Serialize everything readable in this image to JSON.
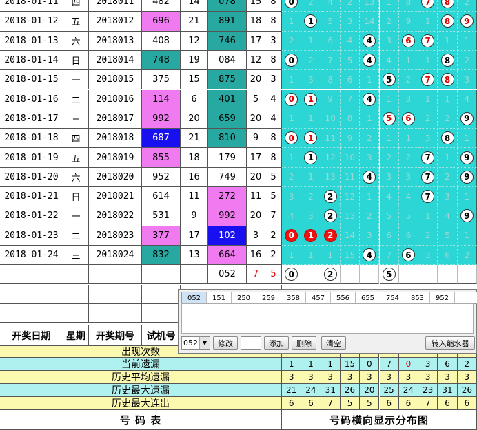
{
  "rows": [
    {
      "date": "2018-01-11",
      "weekday": "四",
      "issue": "2018011",
      "trial": "482",
      "trial_style": "",
      "trial_sum": "14",
      "draw": "078",
      "draw_style": "teal",
      "sum": "15",
      "span": "8",
      "dist": [
        {
          "t": "b",
          "v": "0"
        },
        {
          "t": "n",
          "v": "2"
        },
        {
          "t": "n",
          "v": "4"
        },
        {
          "t": "n",
          "v": "2"
        },
        {
          "t": "n",
          "v": "13"
        },
        {
          "t": "n",
          "v": "1"
        },
        {
          "t": "n",
          "v": "8"
        },
        {
          "t": "r",
          "v": "7"
        },
        {
          "t": "r",
          "v": "8"
        },
        {
          "t": "n",
          "v": "2"
        }
      ]
    },
    {
      "date": "2018-01-12",
      "weekday": "五",
      "issue": "2018012",
      "trial": "696",
      "trial_style": "pink",
      "trial_sum": "21",
      "draw": "891",
      "draw_style": "teal",
      "sum": "18",
      "span": "8",
      "dist": [
        {
          "t": "n",
          "v": "1"
        },
        {
          "t": "b",
          "v": "1"
        },
        {
          "t": "n",
          "v": "5"
        },
        {
          "t": "n",
          "v": "3"
        },
        {
          "t": "n",
          "v": "14"
        },
        {
          "t": "n",
          "v": "2"
        },
        {
          "t": "n",
          "v": "9"
        },
        {
          "t": "n",
          "v": "1"
        },
        {
          "t": "r",
          "v": "8"
        },
        {
          "t": "r",
          "v": "9"
        }
      ]
    },
    {
      "date": "2018-01-13",
      "weekday": "六",
      "issue": "2018013",
      "trial": "408",
      "trial_style": "",
      "trial_sum": "12",
      "draw": "746",
      "draw_style": "teal",
      "sum": "17",
      "span": "3",
      "dist": [
        {
          "t": "n",
          "v": "2"
        },
        {
          "t": "n",
          "v": "1"
        },
        {
          "t": "n",
          "v": "6"
        },
        {
          "t": "n",
          "v": "4"
        },
        {
          "t": "b",
          "v": "4"
        },
        {
          "t": "n",
          "v": "3"
        },
        {
          "t": "r",
          "v": "6"
        },
        {
          "t": "r",
          "v": "7"
        },
        {
          "t": "n",
          "v": "1"
        },
        {
          "t": "n",
          "v": "1"
        }
      ]
    },
    {
      "date": "2018-01-14",
      "weekday": "日",
      "issue": "2018014",
      "trial": "748",
      "trial_style": "teal",
      "trial_sum": "19",
      "draw": "084",
      "draw_style": "",
      "sum": "12",
      "span": "8",
      "dist": [
        {
          "t": "b",
          "v": "0"
        },
        {
          "t": "n",
          "v": "2"
        },
        {
          "t": "n",
          "v": "7"
        },
        {
          "t": "n",
          "v": "5"
        },
        {
          "t": "b",
          "v": "4"
        },
        {
          "t": "n",
          "v": "4"
        },
        {
          "t": "n",
          "v": "1"
        },
        {
          "t": "n",
          "v": "1"
        },
        {
          "t": "b",
          "v": "8"
        },
        {
          "t": "n",
          "v": "2"
        }
      ]
    },
    {
      "date": "2018-01-15",
      "weekday": "一",
      "issue": "2018015",
      "trial": "375",
      "trial_style": "",
      "trial_sum": "15",
      "draw": "875",
      "draw_style": "teal",
      "sum": "20",
      "span": "3",
      "dist": [
        {
          "t": "n",
          "v": "1"
        },
        {
          "t": "n",
          "v": "3"
        },
        {
          "t": "n",
          "v": "8"
        },
        {
          "t": "n",
          "v": "6"
        },
        {
          "t": "n",
          "v": "1"
        },
        {
          "t": "b",
          "v": "5"
        },
        {
          "t": "n",
          "v": "2"
        },
        {
          "t": "r",
          "v": "7"
        },
        {
          "t": "r",
          "v": "8"
        },
        {
          "t": "n",
          "v": "3"
        }
      ]
    },
    {
      "date": "2018-01-16",
      "weekday": "二",
      "issue": "2018016",
      "trial": "114",
      "trial_style": "pink",
      "trial_sum": "6",
      "draw": "401",
      "draw_style": "teal",
      "sum": "5",
      "span": "4",
      "dist": [
        {
          "t": "r",
          "v": "0"
        },
        {
          "t": "r",
          "v": "1"
        },
        {
          "t": "n",
          "v": "9"
        },
        {
          "t": "n",
          "v": "7"
        },
        {
          "t": "b",
          "v": "4"
        },
        {
          "t": "n",
          "v": "1"
        },
        {
          "t": "n",
          "v": "3"
        },
        {
          "t": "n",
          "v": "1"
        },
        {
          "t": "n",
          "v": "1"
        },
        {
          "t": "n",
          "v": "4"
        }
      ]
    },
    {
      "date": "2018-01-17",
      "weekday": "三",
      "issue": "2018017",
      "trial": "992",
      "trial_style": "pink",
      "trial_sum": "20",
      "draw": "659",
      "draw_style": "teal",
      "sum": "20",
      "span": "4",
      "dist": [
        {
          "t": "n",
          "v": "1"
        },
        {
          "t": "n",
          "v": "1"
        },
        {
          "t": "n",
          "v": "10"
        },
        {
          "t": "n",
          "v": "8"
        },
        {
          "t": "n",
          "v": "1"
        },
        {
          "t": "r",
          "v": "5"
        },
        {
          "t": "r",
          "v": "6"
        },
        {
          "t": "n",
          "v": "2"
        },
        {
          "t": "n",
          "v": "2"
        },
        {
          "t": "b",
          "v": "9"
        }
      ]
    },
    {
      "date": "2018-01-18",
      "weekday": "四",
      "issue": "2018018",
      "trial": "687",
      "trial_style": "blue",
      "trial_sum": "21",
      "draw": "810",
      "draw_style": "teal",
      "sum": "9",
      "span": "8",
      "dist": [
        {
          "t": "r",
          "v": "0"
        },
        {
          "t": "r",
          "v": "1"
        },
        {
          "t": "n",
          "v": "11"
        },
        {
          "t": "n",
          "v": "9"
        },
        {
          "t": "n",
          "v": "2"
        },
        {
          "t": "n",
          "v": "1"
        },
        {
          "t": "n",
          "v": "1"
        },
        {
          "t": "n",
          "v": "3"
        },
        {
          "t": "b",
          "v": "8"
        },
        {
          "t": "n",
          "v": "1"
        }
      ]
    },
    {
      "date": "2018-01-19",
      "weekday": "五",
      "issue": "2018019",
      "trial": "855",
      "trial_style": "pink",
      "trial_sum": "18",
      "draw": "179",
      "draw_style": "",
      "sum": "17",
      "span": "8",
      "dist": [
        {
          "t": "n",
          "v": "1"
        },
        {
          "t": "b",
          "v": "1"
        },
        {
          "t": "n",
          "v": "12"
        },
        {
          "t": "n",
          "v": "10"
        },
        {
          "t": "n",
          "v": "3"
        },
        {
          "t": "n",
          "v": "2"
        },
        {
          "t": "n",
          "v": "2"
        },
        {
          "t": "b",
          "v": "7"
        },
        {
          "t": "n",
          "v": "1"
        },
        {
          "t": "b",
          "v": "9"
        }
      ]
    },
    {
      "date": "2018-01-20",
      "weekday": "六",
      "issue": "2018020",
      "trial": "952",
      "trial_style": "",
      "trial_sum": "16",
      "draw": "749",
      "draw_style": "",
      "sum": "20",
      "span": "5",
      "dist": [
        {
          "t": "n",
          "v": "2"
        },
        {
          "t": "n",
          "v": "1"
        },
        {
          "t": "n",
          "v": "13"
        },
        {
          "t": "n",
          "v": "11"
        },
        {
          "t": "b",
          "v": "4"
        },
        {
          "t": "n",
          "v": "3"
        },
        {
          "t": "n",
          "v": "3"
        },
        {
          "t": "b",
          "v": "7"
        },
        {
          "t": "n",
          "v": "2"
        },
        {
          "t": "b",
          "v": "9"
        }
      ]
    },
    {
      "date": "2018-01-21",
      "weekday": "日",
      "issue": "2018021",
      "trial": "614",
      "trial_style": "",
      "trial_sum": "11",
      "draw": "272",
      "draw_style": "pink",
      "sum": "11",
      "span": "5",
      "dist": [
        {
          "t": "n",
          "v": "3"
        },
        {
          "t": "n",
          "v": "2"
        },
        {
          "t": "b",
          "v": "2"
        },
        {
          "t": "n",
          "v": "12"
        },
        {
          "t": "n",
          "v": "1"
        },
        {
          "t": "n",
          "v": "4"
        },
        {
          "t": "n",
          "v": "4"
        },
        {
          "t": "b",
          "v": "7"
        },
        {
          "t": "n",
          "v": "3"
        },
        {
          "t": "n",
          "v": "1"
        }
      ]
    },
    {
      "date": "2018-01-22",
      "weekday": "一",
      "issue": "2018022",
      "trial": "531",
      "trial_style": "",
      "trial_sum": "9",
      "draw": "992",
      "draw_style": "pink",
      "sum": "20",
      "span": "7",
      "dist": [
        {
          "t": "n",
          "v": "4"
        },
        {
          "t": "n",
          "v": "3"
        },
        {
          "t": "b",
          "v": "2"
        },
        {
          "t": "n",
          "v": "13"
        },
        {
          "t": "n",
          "v": "2"
        },
        {
          "t": "n",
          "v": "5"
        },
        {
          "t": "n",
          "v": "5"
        },
        {
          "t": "n",
          "v": "1"
        },
        {
          "t": "n",
          "v": "4"
        },
        {
          "t": "b",
          "v": "9"
        }
      ]
    },
    {
      "date": "2018-01-23",
      "weekday": "二",
      "issue": "2018023",
      "trial": "377",
      "trial_style": "pink",
      "trial_sum": "17",
      "draw": "102",
      "draw_style": "blue",
      "sum": "3",
      "span": "2",
      "dist": [
        {
          "t": "f",
          "v": "0"
        },
        {
          "t": "f",
          "v": "1"
        },
        {
          "t": "f",
          "v": "2"
        },
        {
          "t": "n",
          "v": "14"
        },
        {
          "t": "n",
          "v": "3"
        },
        {
          "t": "n",
          "v": "6"
        },
        {
          "t": "n",
          "v": "6"
        },
        {
          "t": "n",
          "v": "2"
        },
        {
          "t": "n",
          "v": "5"
        },
        {
          "t": "n",
          "v": "1"
        }
      ]
    },
    {
      "date": "2018-01-24",
      "weekday": "三",
      "issue": "2018024",
      "trial": "832",
      "trial_style": "teal",
      "trial_sum": "13",
      "draw": "664",
      "draw_style": "pink",
      "sum": "16",
      "span": "2",
      "dist": [
        {
          "t": "n",
          "v": "1"
        },
        {
          "t": "n",
          "v": "1"
        },
        {
          "t": "n",
          "v": "1"
        },
        {
          "t": "n",
          "v": "15"
        },
        {
          "t": "b",
          "v": "4"
        },
        {
          "t": "n",
          "v": "7"
        },
        {
          "t": "b",
          "v": "6"
        },
        {
          "t": "n",
          "v": "3"
        },
        {
          "t": "n",
          "v": "6"
        },
        {
          "t": "n",
          "v": "2"
        }
      ]
    }
  ],
  "pending": {
    "draw": "052",
    "sum": "7",
    "span": "5",
    "balls": [
      "0",
      "",
      "2",
      "",
      "",
      "5",
      "",
      "",
      "",
      ""
    ]
  },
  "headers": {
    "date": "开奖日期",
    "weekday": "星期",
    "issue": "开奖期号",
    "trial": "试机号"
  },
  "stats": [
    {
      "label": "出现次数",
      "values": [],
      "row": "yellow"
    },
    {
      "label": "当前遗漏",
      "values": [
        "1",
        "1",
        "1",
        "15",
        "0",
        "7",
        "0",
        "3",
        "6",
        "2"
      ],
      "red_index": 6,
      "row": "cyan"
    },
    {
      "label": "历史平均遗漏",
      "values": [
        "3",
        "3",
        "3",
        "3",
        "3",
        "3",
        "3",
        "3",
        "3",
        "3"
      ],
      "red_index": -1,
      "row": "yellow"
    },
    {
      "label": "历史最大遗漏",
      "values": [
        "21",
        "24",
        "31",
        "26",
        "20",
        "25",
        "24",
        "23",
        "31",
        "26"
      ],
      "red_index": -1,
      "row": "cyan"
    },
    {
      "label": "历史最大连出",
      "values": [
        "6",
        "6",
        "7",
        "5",
        "5",
        "6",
        "6",
        "7",
        "6",
        "6"
      ],
      "red_index": -1,
      "row": "yellow"
    }
  ],
  "footer": {
    "left": "号  码  表",
    "right": "号码横向显示分布图"
  },
  "panel": {
    "tabs": [
      "052",
      "151",
      "250",
      "259",
      "358",
      "457",
      "556",
      "655",
      "754",
      "853",
      "952"
    ],
    "selected": "052",
    "edit": "修改",
    "add": "添加",
    "delete": "删除",
    "clear": "清空",
    "shrink": "转入缩水器"
  }
}
